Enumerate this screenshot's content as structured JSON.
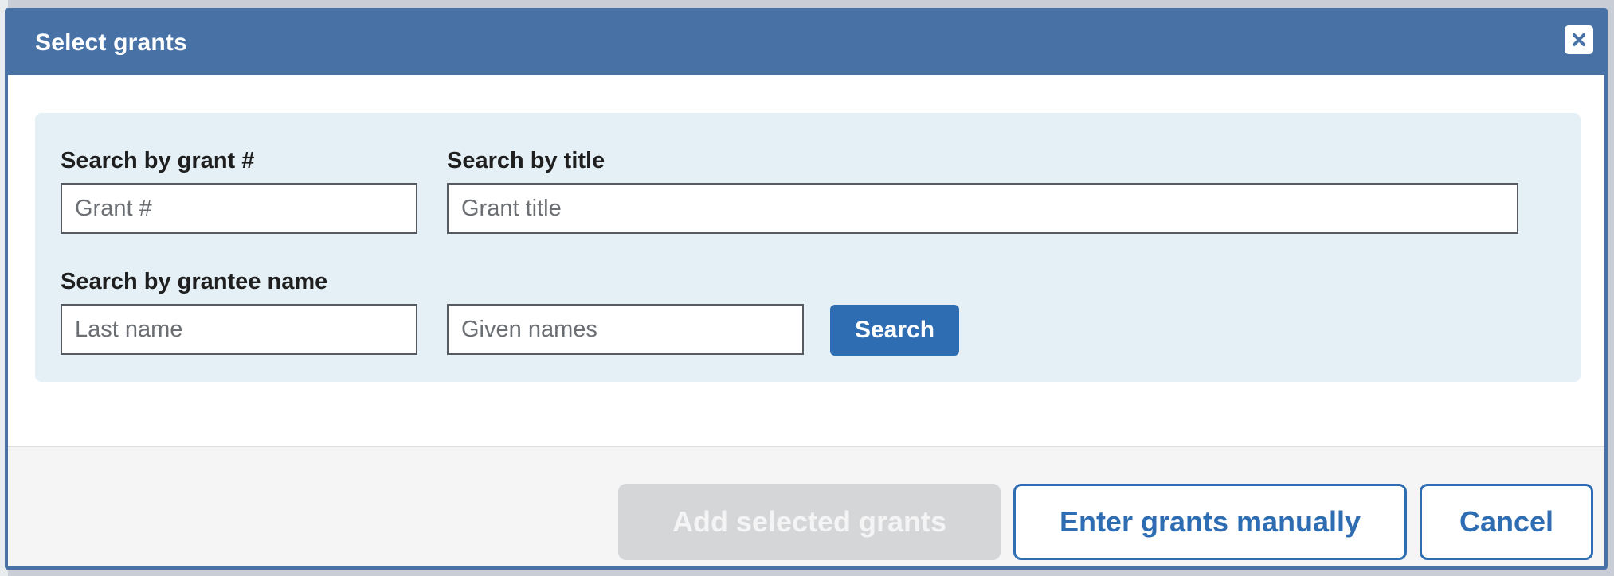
{
  "dialog": {
    "title": "Select grants",
    "close_icon": "close-icon"
  },
  "search": {
    "grant_number_label": "Search by grant #",
    "grant_number_placeholder": "Grant #",
    "title_label": "Search by title",
    "title_placeholder": "Grant title",
    "grantee_label": "Search by grantee name",
    "last_name_placeholder": "Last name",
    "given_names_placeholder": "Given names",
    "search_button": "Search"
  },
  "footer": {
    "add_selected_label": "Add selected grants",
    "enter_manually_label": "Enter grants manually",
    "cancel_label": "Cancel"
  },
  "colors": {
    "header": "#4872a6",
    "primary": "#2f6db3",
    "panel": "#e4f0f6",
    "disabled": "#d5d6d8"
  }
}
